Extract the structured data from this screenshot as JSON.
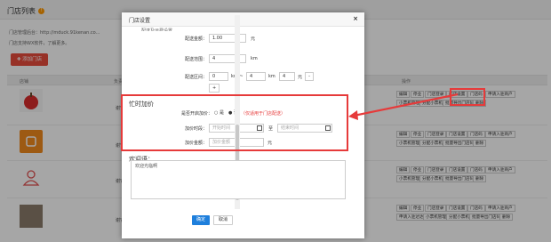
{
  "page": {
    "title": "门店列表",
    "info_icon": "info-icon",
    "line1": "门店管理后台：http://mduck.91kenan.co...",
    "line2": "门店支持WX软件，了解更多。",
    "add_button": "添加门店",
    "columns": [
      "店铺",
      "负责",
      "操作"
    ],
    "row_texts": [
      "谢它",
      "谢它",
      "谢它",
      "谢它"
    ],
    "ops_row1": [
      "编辑",
      "停业",
      "门店登录",
      "门店设置",
      "门店码",
      "申请入驻商户"
    ],
    "ops_row2": [
      "小票机管理",
      "分配小票机",
      "批量导出门店码",
      "删除"
    ],
    "ops_row3": [
      "申请入驻达达",
      "小票机管理",
      "分配小票机",
      "批量导出门店码",
      "删除"
    ]
  },
  "modal": {
    "title": "门店设置",
    "close_symbol": "×",
    "top_label_cut": "配送及运费设置",
    "fields": {
      "start_amount_label": "配送金额：",
      "start_amount_value": "1.00",
      "start_amount_unit": "元",
      "range_label": "配送范围：",
      "range_value": "4",
      "range_unit": "km",
      "interval_label": "配送区间：",
      "interval_from": "0",
      "interval_km1": "km ~",
      "interval_to": "4",
      "interval_km2": "km",
      "interval_fee": "4",
      "interval_fee_unit": "元",
      "interval_minus": "-",
      "interval_plus": "+"
    },
    "busy": {
      "title": "忙时加价",
      "toggle_label": "是否开启加价：",
      "option_yes": "是",
      "option_no": "否",
      "hint": "（仅适用于门店配送）",
      "time_label": "加价时段：",
      "time_start_placeholder": "开始时间",
      "time_to": "至",
      "time_end_placeholder": "结束时间",
      "amount_label": "加价金额：",
      "amount_placeholder": "加价金额",
      "amount_unit": "元"
    },
    "welcome": {
      "title": "欢迎语：",
      "text": "欢迎光临啊"
    },
    "confirm": "确定",
    "cancel": "取消"
  },
  "colors": {
    "accent_red": "#e63a3a",
    "primary_blue": "#1e7fdc",
    "add_button": "#e84c3d"
  }
}
